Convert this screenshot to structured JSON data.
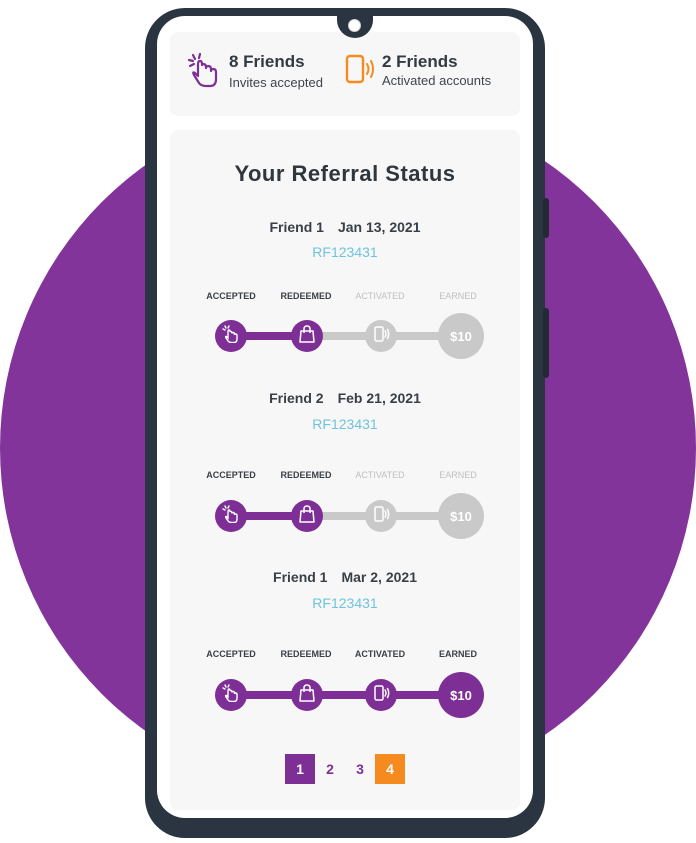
{
  "stats": {
    "invites": {
      "count_label": "8 Friends",
      "sub_label": "Invites accepted"
    },
    "activated": {
      "count_label": "2 Friends",
      "sub_label": "Activated accounts"
    }
  },
  "title": "Your Referral Status",
  "steps": [
    "ACCEPTED",
    "REDEEMED",
    "ACTIVATED",
    "EARNED"
  ],
  "earned_amount": "$10",
  "referrals": [
    {
      "name": "Friend 1",
      "date": "Jan 13, 2021",
      "code": "RF123431",
      "progress_steps": 2
    },
    {
      "name": "Friend 2",
      "date": "Feb 21, 2021",
      "code": "RF123431",
      "progress_steps": 2
    },
    {
      "name": "Friend 1",
      "date": "Mar 2, 2021",
      "code": "RF123431",
      "progress_steps": 4
    }
  ],
  "pagination": [
    {
      "label": "1",
      "state": "active"
    },
    {
      "label": "2",
      "state": "normal"
    },
    {
      "label": "3",
      "state": "normal"
    },
    {
      "label": "4",
      "state": "highlight"
    }
  ],
  "colors": {
    "purple": "#7e2f95",
    "orange": "#f58a1f",
    "inactive": "#c9c9c9",
    "code": "#6ec4dc",
    "background_circle": "#83349a"
  },
  "icons": {
    "accepted": "hand-tap-icon",
    "redeemed": "shopping-bag-icon",
    "activated": "phone-vibrate-icon"
  }
}
